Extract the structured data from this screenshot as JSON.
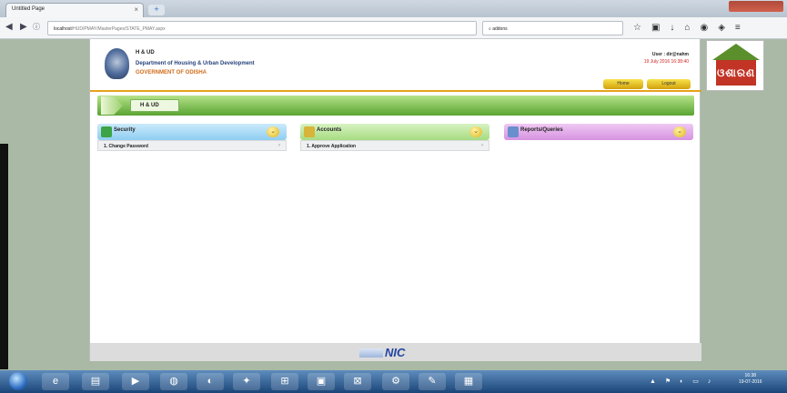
{
  "browser": {
    "tab_title": "Untitled Page",
    "tab_close": "×",
    "new_tab": "+",
    "url_host": "localhost",
    "url_path": "/HUD/PMAY/MasterPages/STATE_PMAY.aspx",
    "search_text": "addons",
    "toolbar_icons": [
      "star-icon",
      "clipboard-icon",
      "download-icon",
      "home-icon",
      "pocket-icon",
      "shield-icon",
      "menu-icon"
    ]
  },
  "header": {
    "org_short": "H & UD",
    "department": "Department of Housing & Urban Development",
    "government": "GOVERNMENT OF ODISHA",
    "user_label": "User : dir@nahm",
    "datetime": "19 July 2016 16:38:40",
    "home_button": "Home",
    "logout_button": "Logout"
  },
  "section_bar": {
    "label": "H & UD"
  },
  "panels": [
    {
      "title": "Security",
      "items": [
        "1.  Change Password"
      ],
      "color": "#9fd4f2"
    },
    {
      "title": "Accounts",
      "items": [
        "1.  Approve Application"
      ],
      "color": "#b7e59a"
    },
    {
      "title": "Reports/Queries",
      "items": [],
      "color": "#e2a6ea"
    }
  ],
  "footer": {
    "logo_text": "NIC"
  },
  "right_logo": {
    "text": "ଓଶାରଣ"
  },
  "taskbar": {
    "apps": [
      "ie-icon",
      "folder-icon",
      "media-icon",
      "chrome-icon",
      "firefox-icon",
      "game-icon",
      "network-icon",
      "window-icon",
      "excel-icon",
      "tools-icon",
      "paint-icon",
      "image-icon"
    ],
    "clock_time": "16:38",
    "clock_date": "19-07-2016"
  }
}
